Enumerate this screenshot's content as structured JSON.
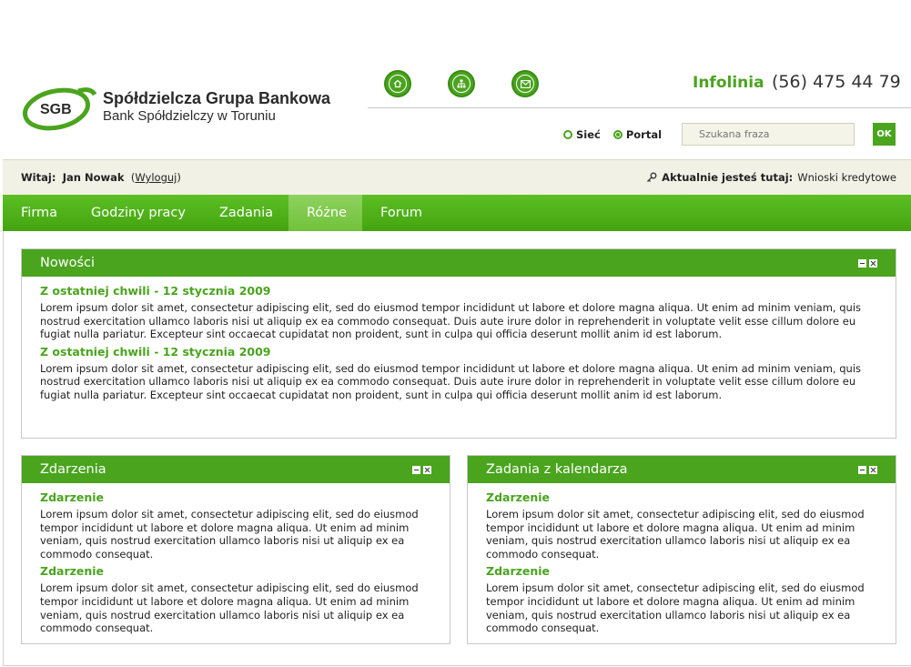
{
  "brand": {
    "logo_mark": "SGB",
    "name": "Spółdzielcza Grupa Bankowa",
    "subtitle": "Bank Spółdzielczy w Toruniu",
    "accent": "#4aa41e"
  },
  "header": {
    "icons": [
      "home-icon",
      "sitemap-icon",
      "mail-icon"
    ],
    "infolinia_label": "Infolinia",
    "phone": "(56) 475 44 79",
    "scope_options": [
      {
        "label": "Sieć",
        "selected": false
      },
      {
        "label": "Portal",
        "selected": true
      }
    ],
    "search_placeholder": "Szukana fraza",
    "search_button": "OK"
  },
  "userbar": {
    "greeting_label": "Witaj:",
    "user_name": "Jan Nowak",
    "logout": "Wyloguj",
    "location_label": "Aktualnie jesteś tutaj:",
    "location_value": "Wnioski kredytowe"
  },
  "nav": {
    "items": [
      "Firma",
      "Godziny pracy",
      "Zadania",
      "Różne",
      "Forum"
    ],
    "active": "Różne"
  },
  "panels": {
    "news": {
      "title": "Nowości",
      "entries": [
        {
          "title": "Z ostatniej chwili - 12 stycznia 2009",
          "text": "Lorem ipsum dolor sit amet, consectetur adipiscing elit, sed do eiusmod tempor incididunt ut labore et dolore magna aliqua. Ut enim ad minim veniam, quis nostrud exercitation ullamco laboris nisi ut aliquip ex ea commodo consequat. Duis aute irure dolor in reprehenderit in voluptate velit esse cillum dolore eu fugiat nulla pariatur. Excepteur sint occaecat cupidatat non proident, sunt in culpa qui officia deserunt mollit anim id est laborum."
        },
        {
          "title": "Z ostatniej chwili - 12 stycznia 2009",
          "text": "Lorem ipsum dolor sit amet, consectetur adipiscing elit, sed do eiusmod tempor incididunt ut labore et dolore magna aliqua. Ut enim ad minim veniam, quis nostrud exercitation ullamco laboris nisi ut aliquip ex ea commodo consequat. Duis aute irure dolor in reprehenderit in voluptate velit esse cillum dolore eu fugiat nulla pariatur. Excepteur sint occaecat cupidatat non proident, sunt in culpa qui officia deserunt mollit anim id est laborum."
        }
      ]
    },
    "events": {
      "title": "Zdarzenia",
      "entries": [
        {
          "title": "Zdarzenie",
          "text": "Lorem ipsum dolor sit amet, consectetur adipiscing elit, sed do eiusmod tempor incididunt ut labore et dolore magna aliqua. Ut enim ad minim veniam, quis nostrud exercitation ullamco laboris nisi ut aliquip ex ea commodo consequat."
        },
        {
          "title": "Zdarzenie",
          "text": "Lorem ipsum dolor sit amet, consectetur adipiscing elit, sed do eiusmod tempor incididunt ut labore et dolore magna aliqua. Ut enim ad minim veniam, quis nostrud exercitation ullamco laboris nisi ut aliquip ex ea commodo consequat."
        }
      ]
    },
    "calendar": {
      "title": "Zadania z kalendarza",
      "entries": [
        {
          "title": "Zdarzenie",
          "text": "Lorem ipsum dolor sit amet, consectetur adipiscing elit, sed do eiusmod tempor incididunt ut labore et dolore magna aliqua. Ut enim ad minim veniam, quis nostrud exercitation ullamco laboris nisi ut aliquip ex ea commodo consequat."
        },
        {
          "title": "Zdarzenie",
          "text": "Lorem ipsum dolor sit amet, consectetur adipiscing elit, sed do eiusmod tempor incididunt ut labore et dolore magna aliqua. Ut enim ad minim veniam, quis nostrud exercitation ullamco laboris nisi ut aliquip ex ea commodo consequat."
        }
      ]
    }
  }
}
